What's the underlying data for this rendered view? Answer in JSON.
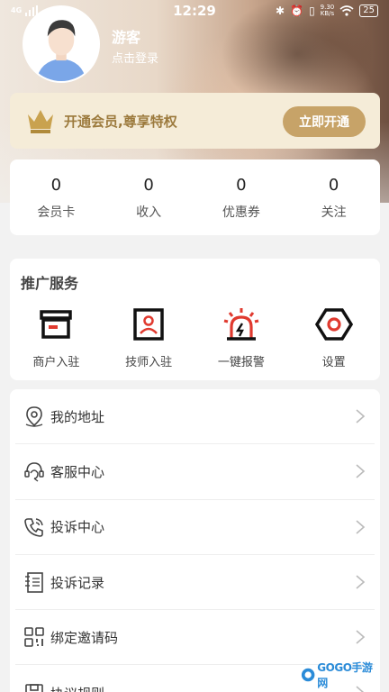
{
  "status_bar": {
    "time": "12:29",
    "network": "4G",
    "net_speed_value": "9.30",
    "net_speed_unit": "KB/s",
    "battery": "25"
  },
  "profile": {
    "name": "游客",
    "login_prompt": "点击登录"
  },
  "vip": {
    "text": "开通会员,尊享特权",
    "button": "立即开通",
    "accent": "#c7a368"
  },
  "stats": [
    {
      "value": "0",
      "label": "会员卡"
    },
    {
      "value": "0",
      "label": "收入"
    },
    {
      "value": "0",
      "label": "优惠券"
    },
    {
      "value": "0",
      "label": "关注"
    }
  ],
  "promo": {
    "title": "推广服务",
    "items": [
      {
        "label": "商户入驻",
        "icon": "store-icon"
      },
      {
        "label": "技师入驻",
        "icon": "technician-icon"
      },
      {
        "label": "一键报警",
        "icon": "alarm-icon"
      },
      {
        "label": "设置",
        "icon": "settings-icon"
      }
    ]
  },
  "menu": [
    {
      "label": "我的地址",
      "icon": "location-icon"
    },
    {
      "label": "客服中心",
      "icon": "customer-service-icon"
    },
    {
      "label": "投诉中心",
      "icon": "phone-icon"
    },
    {
      "label": "投诉记录",
      "icon": "notebook-icon"
    },
    {
      "label": "绑定邀请码",
      "icon": "qr-code-icon"
    },
    {
      "label": "协议规则",
      "icon": "document-icon"
    }
  ],
  "watermark": {
    "text": "GOGO手游网"
  }
}
